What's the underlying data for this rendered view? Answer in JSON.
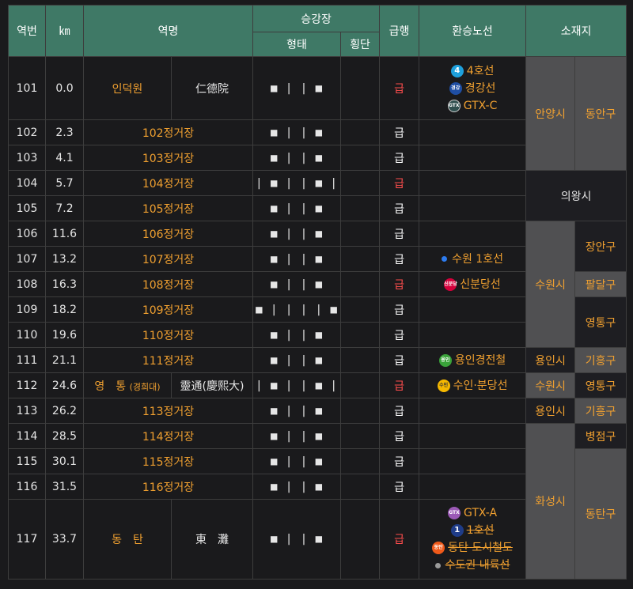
{
  "header": {
    "station_no": "역번",
    "km": "㎞",
    "station_name": "역명",
    "platform": "승강장",
    "platform_form": "형태",
    "platform_crossing": "횡단",
    "express": "급행",
    "transfer": "환승노선",
    "location": "소재지"
  },
  "rows": [
    {
      "no": "101",
      "km": "0.0",
      "name": "인덕원",
      "hanja": "仁德院",
      "form": "■ | | ■",
      "express": "급",
      "express_color": "red"
    },
    {
      "no": "102",
      "km": "2.3",
      "name": "102정거장",
      "form": "■ | | ■",
      "express": "급",
      "express_color": "white"
    },
    {
      "no": "103",
      "km": "4.1",
      "name": "103정거장",
      "form": "■ | | ■",
      "express": "급",
      "express_color": "white"
    },
    {
      "no": "104",
      "km": "5.7",
      "name": "104정거장",
      "form": "| ■ | | ■ |",
      "express": "급",
      "express_color": "red"
    },
    {
      "no": "105",
      "km": "7.2",
      "name": "105정거장",
      "form": "■ | | ■",
      "express": "급",
      "express_color": "white"
    },
    {
      "no": "106",
      "km": "11.6",
      "name": "106정거장",
      "form": "■ | | ■",
      "express": "급",
      "express_color": "white"
    },
    {
      "no": "107",
      "km": "13.2",
      "name": "107정거장",
      "form": "■ | | ■",
      "express": "급",
      "express_color": "white"
    },
    {
      "no": "108",
      "km": "16.3",
      "name": "108정거장",
      "form": "■ | | ■",
      "express": "급",
      "express_color": "red"
    },
    {
      "no": "109",
      "km": "18.2",
      "name": "109정거장",
      "form": "■ | | | | ■",
      "express": "급",
      "express_color": "white"
    },
    {
      "no": "110",
      "km": "19.6",
      "name": "110정거장",
      "form": "■ | | ■",
      "express": "급",
      "express_color": "white"
    },
    {
      "no": "111",
      "km": "21.1",
      "name": "111정거장",
      "form": "■ | | ■",
      "express": "급",
      "express_color": "white"
    },
    {
      "no": "112",
      "km": "24.6",
      "name": "영　통",
      "name_sub": "(경희대)",
      "hanja": "靈通(慶熙大)",
      "form": "| ■ | | ■ |",
      "express": "급",
      "express_color": "red"
    },
    {
      "no": "113",
      "km": "26.2",
      "name": "113정거장",
      "form": "■ | | ■",
      "express": "급",
      "express_color": "white"
    },
    {
      "no": "114",
      "km": "28.5",
      "name": "114정거장",
      "form": "■ | | ■",
      "express": "급",
      "express_color": "white"
    },
    {
      "no": "115",
      "km": "30.1",
      "name": "115정거장",
      "form": "■ | | ■",
      "express": "급",
      "express_color": "white"
    },
    {
      "no": "116",
      "km": "31.5",
      "name": "116정거장",
      "form": "■ | | ■",
      "express": "급",
      "express_color": "white"
    },
    {
      "no": "117",
      "km": "33.7",
      "name": "동　탄",
      "hanja": "東　灘",
      "form": "■ | | ■",
      "express": "급",
      "express_color": "red"
    }
  ],
  "transfers": {
    "r101": [
      {
        "icon": "4",
        "color": "#1ea0dc",
        "label": "4호선"
      },
      {
        "icon": "경강",
        "color": "#1f4ea3",
        "label": "경강선"
      },
      {
        "icon": "GTX",
        "color": "#2f4f4f",
        "label": "GTX-C"
      }
    ],
    "r107": [
      {
        "icon": "",
        "color": "#2d7cf0",
        "label": "수원 1호선"
      }
    ],
    "r108": [
      {
        "icon": "신분당",
        "color": "#d4003b",
        "label": "신분당선"
      }
    ],
    "r111": [
      {
        "icon": "용인",
        "color": "#3aa33a",
        "label": "용인경전철"
      }
    ],
    "r112": [
      {
        "icon": "수인",
        "color": "#f5b800",
        "label": "수인·분당선"
      }
    ],
    "r117": [
      {
        "icon": "GTX",
        "color": "#9b59b6",
        "label": "GTX-A"
      },
      {
        "icon": "1",
        "color": "#1f3c88",
        "label": "1호선"
      },
      {
        "icon": "동탄",
        "color": "#f05a1a",
        "label": "동탄 도시철도"
      },
      {
        "icon": "",
        "color": "#9a9a9a",
        "label": "수도권 내륙선"
      }
    ]
  },
  "locations": {
    "anyang": "안양시",
    "dongan": "동안구",
    "uiwang": "의왕시",
    "suwon": "수원시",
    "jangan": "장안구",
    "paldal": "팔달구",
    "yeongtong1": "영통구",
    "yongin1": "용인시",
    "giheung1": "기흥구",
    "suwon2": "수원시",
    "yeongtong2": "영통구",
    "yongin2": "용인시",
    "giheung2": "기흥구",
    "hwaseong": "화성시",
    "byeongjeom": "병점구",
    "dongtan": "동탄구"
  },
  "colors": {
    "header_bg": "#3f7966",
    "station_orange": "#f0a030",
    "express_red": "#ff4d4d",
    "location_grey": "#505052"
  }
}
